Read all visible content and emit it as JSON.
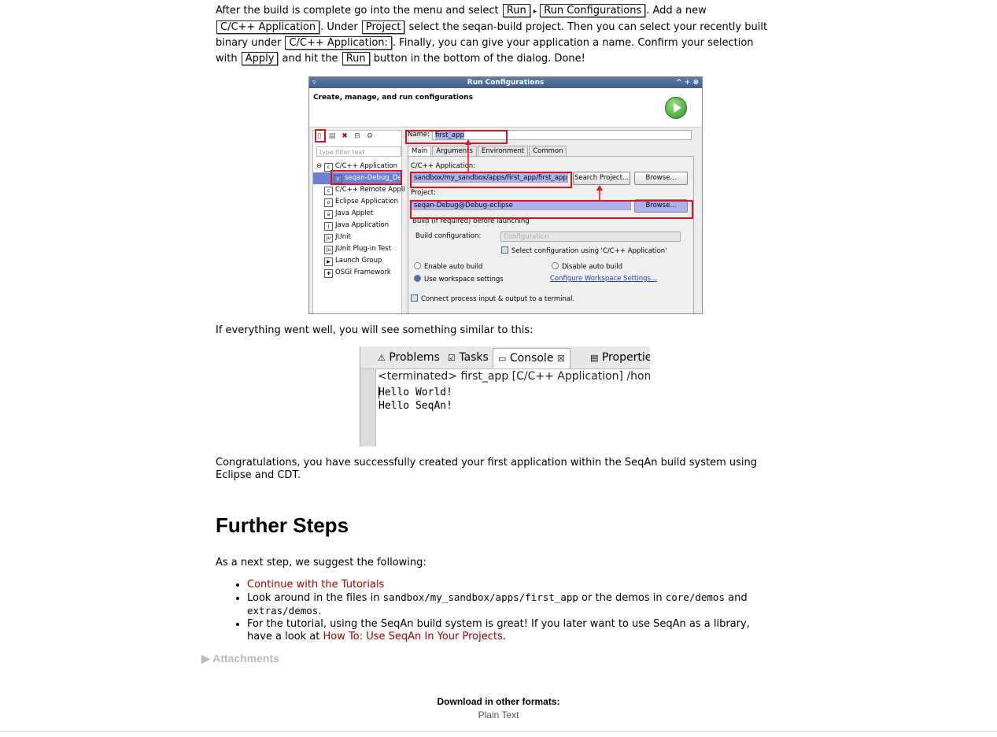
{
  "para1": {
    "t1": "After the build is complete go into the menu and select ",
    "k_run": "Run",
    "arrow": "▸",
    "k_runcfg": "Run Configurations",
    "t2": ". Add a new",
    "k_app": "C/C++ Application",
    "t3": ". Under ",
    "k_project": "Project",
    "t4": " select the seqan-build project. Then you can select your recently built",
    "t5": "binary under ",
    "k_appc": "C/C++ Application:",
    "t6": ". Finally, you can give your application a name. Confirm your selection",
    "t7": "with ",
    "k_apply": "Apply",
    "t8": " and hit the ",
    "k_run2": "Run",
    "t9": " button in the bottom of the dialog. Done!"
  },
  "dialog": {
    "title": "Run Configurations",
    "title_controls": "^ + ⊗",
    "header": "Create, manage, and run configurations",
    "filter_placeholder": "type filter text",
    "tree": [
      {
        "label": "C/C++ Application",
        "icon": "c"
      },
      {
        "label": "seqan-Debug_Del",
        "icon": "c",
        "selected": true
      },
      {
        "label": "C/C++ Remote Appli",
        "icon": "c"
      },
      {
        "label": "Eclipse Application",
        "icon": "o"
      },
      {
        "label": "Java Applet",
        "icon": "a"
      },
      {
        "label": "Java Application",
        "icon": "j"
      },
      {
        "label": "JUnit",
        "icon": "Ju"
      },
      {
        "label": "JUnit Plug-in Test",
        "icon": "Ju"
      },
      {
        "label": "Launch Group",
        "icon": "▶"
      },
      {
        "label": "OSGi Framework",
        "icon": "✚"
      }
    ],
    "name_label": "Name:",
    "name_value": "first_app",
    "tabs": [
      "Main",
      "Arguments",
      "Environment",
      "Common"
    ],
    "app_label": "C/C++ Application:",
    "app_value": "sandbox/my_sandbox/apps/first_app/first_app",
    "search_project": "Search Project...",
    "browse": "Browse...",
    "project_label": "Project:",
    "project_value": "seqan-Debug@Debug-eclipse",
    "build_section": "Build (if required) before launching",
    "build_config_label": "Build configuration:",
    "build_config_value": "Configuration",
    "select_config": "Select configuration using 'C/C++ Application'",
    "enable_auto": "Enable auto build",
    "disable_auto": "Disable auto build",
    "use_workspace": "Use workspace settings",
    "configure_ws": "Configure Workspace Settings...",
    "connect_io": "Connect process input & output to a terminal."
  },
  "para2": "If everything went well, you will see something similar to this:",
  "console": {
    "tabs": [
      "Problems",
      "Tasks",
      "Console",
      "Propertie"
    ],
    "active_tab": "Console",
    "status": "<terminated> first_app [C/C++ Application] /home/h",
    "lines": [
      "Hello World!",
      "Hello SeqAn!"
    ]
  },
  "para3": "Congratulations, you have successfully created your first application within the SeqAn build system using Eclipse and CDT.",
  "heading": "Further Steps",
  "para4": "As a next step, we suggest the following:",
  "bullets": {
    "b1_link": "Continue with the Tutorials",
    "b2_t1": "Look around in the files in ",
    "b2_c1": "sandbox/my_sandbox/apps/first_app",
    "b2_t2": " or the demos in ",
    "b2_c2": "core/demos",
    "b2_t3": " and",
    "b2_c3": "extras/demos",
    "b2_t4": ".",
    "b3_t1": "For the tutorial, using the SeqAn build system is great! If you later want to use SeqAn as a library,",
    "b3_t2": "have a look at ",
    "b3_link": "How To: Use SeqAn In Your Projects",
    "b3_t3": "."
  },
  "attachments": "▶ Attachments",
  "download": {
    "title": "Download in other formats:",
    "link": "Plain Text"
  }
}
